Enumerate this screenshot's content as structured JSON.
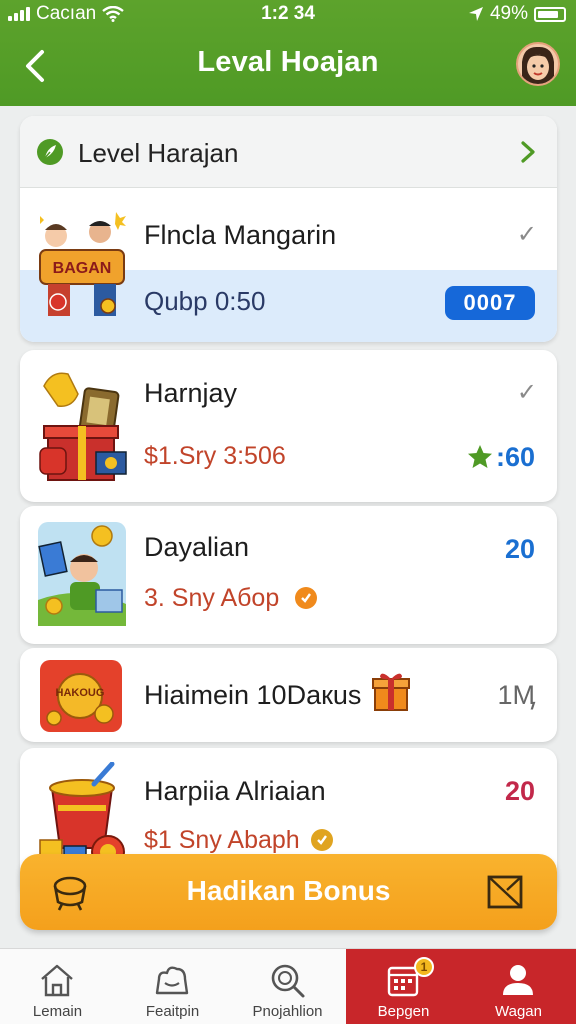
{
  "status_bar": {
    "carrier": "Cacıan",
    "time": "1:2 34",
    "battery": "49%"
  },
  "header": {
    "title": "Leval Hoajan"
  },
  "section": {
    "title": "Level Harajan"
  },
  "items": [
    {
      "name": "Flncla Mangarin",
      "sub": "Qubp 0:50",
      "value": "0007",
      "check": "✓",
      "thumb_text": "BAGAN"
    },
    {
      "name": "Harnjay",
      "sub": "$1.Sry 3:506",
      "value": ":60",
      "check": "✓"
    },
    {
      "name": "Dayalian",
      "sub": "3. Sny Aбop",
      "value": "20"
    },
    {
      "name": "Hiaimein 10Daкus",
      "value": "1Ӎ",
      "thumb_text": "HAKOUG"
    },
    {
      "name": "Harpiia Alriaian",
      "sub": "$1 Sny Abaph",
      "value": "20"
    }
  ],
  "bonus_button": {
    "label": "Hadikan Bonus"
  },
  "tabs": [
    {
      "label": "Lemain",
      "icon": "home-icon"
    },
    {
      "label": "Feaitpin",
      "icon": "bag-icon"
    },
    {
      "label": "Pnojahlion",
      "icon": "magnifier-icon"
    },
    {
      "label": "Bepgen",
      "icon": "calendar-icon",
      "active": true,
      "badge": "1"
    },
    {
      "label": "Wagan",
      "icon": "person-icon"
    }
  ],
  "colors": {
    "header_green": "#5da32c",
    "value_blue": "#1a6fd1",
    "value_red": "#c2284a",
    "sub_red": "#c1442a",
    "active_tab": "#c8262a",
    "bonus_orange": "#f6a623"
  }
}
